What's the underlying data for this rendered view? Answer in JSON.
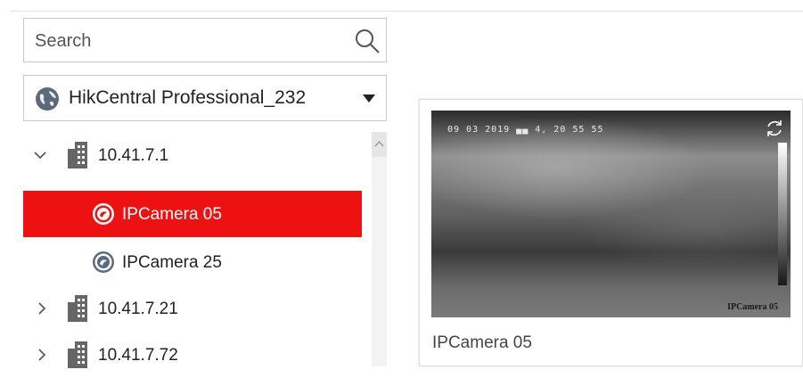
{
  "search": {
    "placeholder": "Search"
  },
  "site": {
    "name": "HikCentral Professional_232"
  },
  "tree": {
    "nodes": [
      {
        "label": "10.41.7.1",
        "type": "area",
        "state": "expanded"
      },
      {
        "label": "IPCamera 05",
        "type": "camera",
        "selected": true
      },
      {
        "label": "IPCamera 25",
        "type": "camera",
        "selected": false
      },
      {
        "label": "10.41.7.21",
        "type": "area",
        "state": "collapsed"
      },
      {
        "label": "10.41.7.72",
        "type": "area",
        "state": "collapsed"
      }
    ]
  },
  "preview": {
    "osd_time": "09 03 2019 ▄▄ 4,    20 55 55",
    "osd_camera": "IPCamera 05",
    "caption": "IPCamera 05"
  },
  "colors": {
    "selected_bg": "#ee1111",
    "building_icon": "#666666",
    "camera_icon": "#5a6b80"
  }
}
